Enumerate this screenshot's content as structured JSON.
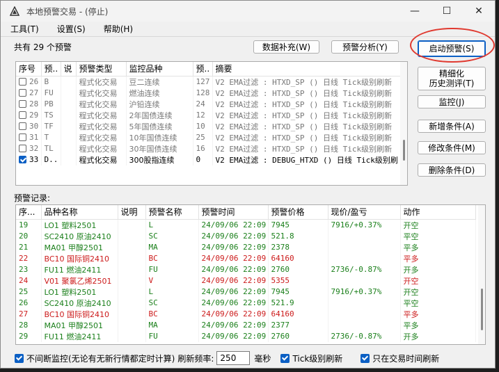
{
  "window": {
    "title": "本地预警交易 - (停止)",
    "minimize": "—",
    "maximize": "☐",
    "close": "✕"
  },
  "menu": [
    "工具(T)",
    "设置(S)",
    "帮助(H)"
  ],
  "summary": "共有 29 个预警",
  "buttons": {
    "data_fill": "数据补充(W)",
    "alert_analysis": "预警分析(Y)",
    "start_alert": "启动预警(S)",
    "refine_backtest_line1": "精细化",
    "refine_backtest_line2": "历史测评(T)",
    "monitor": "监控(J)",
    "add_condition": "新增条件(A)",
    "modify_condition": "修改条件(M)",
    "delete_condition": "删除条件(D)"
  },
  "rules_table": {
    "headers": [
      "序号",
      "预..",
      "说",
      "预警类型",
      "监控品种",
      "预..",
      "摘要"
    ],
    "rows": [
      {
        "checked": false,
        "no": "26",
        "code": "B",
        "note": "",
        "type": "程式化交易",
        "symbol": "豆二连续",
        "count": "127",
        "summary": "V2 EMA过滤 : HTXD_SP () 日线 Tick级别刷新"
      },
      {
        "checked": false,
        "no": "27",
        "code": "FU",
        "note": "",
        "type": "程式化交易",
        "symbol": "燃油连续",
        "count": "128",
        "summary": "V2 EMA过滤 : HTXD_SP () 日线 Tick级别刷新"
      },
      {
        "checked": false,
        "no": "28",
        "code": "PB",
        "note": "",
        "type": "程式化交易",
        "symbol": "沪铅连续",
        "count": "24",
        "summary": "V2 EMA过滤 : HTXD_SP () 日线 Tick级别刷新"
      },
      {
        "checked": false,
        "no": "29",
        "code": "TS",
        "note": "",
        "type": "程式化交易",
        "symbol": "2年国债连续",
        "count": "12",
        "summary": "V2 EMA过滤 : HTXD_SP () 日线 Tick级别刷新"
      },
      {
        "checked": false,
        "no": "30",
        "code": "TF",
        "note": "",
        "type": "程式化交易",
        "symbol": "5年国债连续",
        "count": "10",
        "summary": "V2 EMA过滤 : HTXD_SP () 日线 Tick级别刷新"
      },
      {
        "checked": false,
        "no": "31",
        "code": "T",
        "note": "",
        "type": "程式化交易",
        "symbol": "10年国债连续",
        "count": "25",
        "summary": "V2 EMA过滤 : HTXD_SP () 日线 Tick级别刷新"
      },
      {
        "checked": false,
        "no": "32",
        "code": "TL",
        "note": "",
        "type": "程式化交易",
        "symbol": "30年国债连续",
        "count": "16",
        "summary": "V2 EMA过滤 : HTXD_SP () 日线 Tick级别刷新"
      },
      {
        "checked": true,
        "no": "33",
        "code": "D..",
        "note": "",
        "type": "程式化交易",
        "symbol": "300股指连续",
        "count": "0",
        "summary": "V2 EMA过滤 : DEBUG_HTXD () 日线 Tick级别刷"
      }
    ]
  },
  "log_label": "预警记录:",
  "log_table": {
    "headers": [
      "序...",
      "品种名称",
      "说明",
      "预警名称",
      "预警时间",
      "预警价格",
      "现价/盈亏",
      "动作"
    ],
    "rows": [
      {
        "no": "19",
        "product": "LO1 塑料2501",
        "note": "",
        "alert": "L",
        "time": "24/09/06 22:09",
        "price": "7945",
        "pnl": "7916/+0.37%",
        "action": "开空",
        "color": "#1a7f1a"
      },
      {
        "no": "20",
        "product": "SC2410 原油2410",
        "note": "",
        "alert": "SC",
        "time": "24/09/06 22:09",
        "price": "521.8",
        "pnl": "",
        "action": "平空",
        "color": "#1a7f1a"
      },
      {
        "no": "21",
        "product": "MA01 甲醇2501",
        "note": "",
        "alert": "MA",
        "time": "24/09/06 22:09",
        "price": "2378",
        "pnl": "",
        "action": "平多",
        "color": "#1a7f1a"
      },
      {
        "no": "22",
        "product": "BC10 国际铜2410",
        "note": "",
        "alert": "BC",
        "time": "24/09/06 22:09",
        "price": "64160",
        "pnl": "",
        "action": "平多",
        "color": "#cc1a1a"
      },
      {
        "no": "23",
        "product": "FU11 燃油2411",
        "note": "",
        "alert": "FU",
        "time": "24/09/06 22:09",
        "price": "2760",
        "pnl": "2736/-0.87%",
        "action": "开多",
        "color": "#1a7f1a"
      },
      {
        "no": "24",
        "product": "V01 聚氯乙烯2501",
        "note": "",
        "alert": "V",
        "time": "24/09/06 22:09",
        "price": "5355",
        "pnl": "",
        "action": "开空",
        "color": "#cc1a1a"
      },
      {
        "no": "25",
        "product": "LO1 塑料2501",
        "note": "",
        "alert": "L",
        "time": "24/09/06 22:09",
        "price": "7945",
        "pnl": "7916/+0.37%",
        "action": "开空",
        "color": "#1a7f1a"
      },
      {
        "no": "26",
        "product": "SC2410 原油2410",
        "note": "",
        "alert": "SC",
        "time": "24/09/06 22:09",
        "price": "521.9",
        "pnl": "",
        "action": "平空",
        "color": "#1a7f1a"
      },
      {
        "no": "27",
        "product": "BC10 国际铜2410",
        "note": "",
        "alert": "BC",
        "time": "24/09/06 22:09",
        "price": "64160",
        "pnl": "",
        "action": "平多",
        "color": "#cc1a1a"
      },
      {
        "no": "28",
        "product": "MA01 甲醇2501",
        "note": "",
        "alert": "MA",
        "time": "24/09/06 22:09",
        "price": "2377",
        "pnl": "",
        "action": "平多",
        "color": "#1a7f1a"
      },
      {
        "no": "29",
        "product": "FU11 燃油2411",
        "note": "",
        "alert": "FU",
        "time": "24/09/06 22:09",
        "price": "2760",
        "pnl": "2736/-0.87%",
        "action": "开多",
        "color": "#1a7f1a"
      }
    ]
  },
  "bottom": {
    "continuous_monitor": "不间断监控(无论有无新行情都定时计算)",
    "refresh_rate_label": "刷新频率:",
    "refresh_rate_value": "250",
    "refresh_rate_unit": "毫秒",
    "tick_refresh": "Tick级别刷新",
    "trade_time_refresh": "只在交易时间刷新"
  }
}
